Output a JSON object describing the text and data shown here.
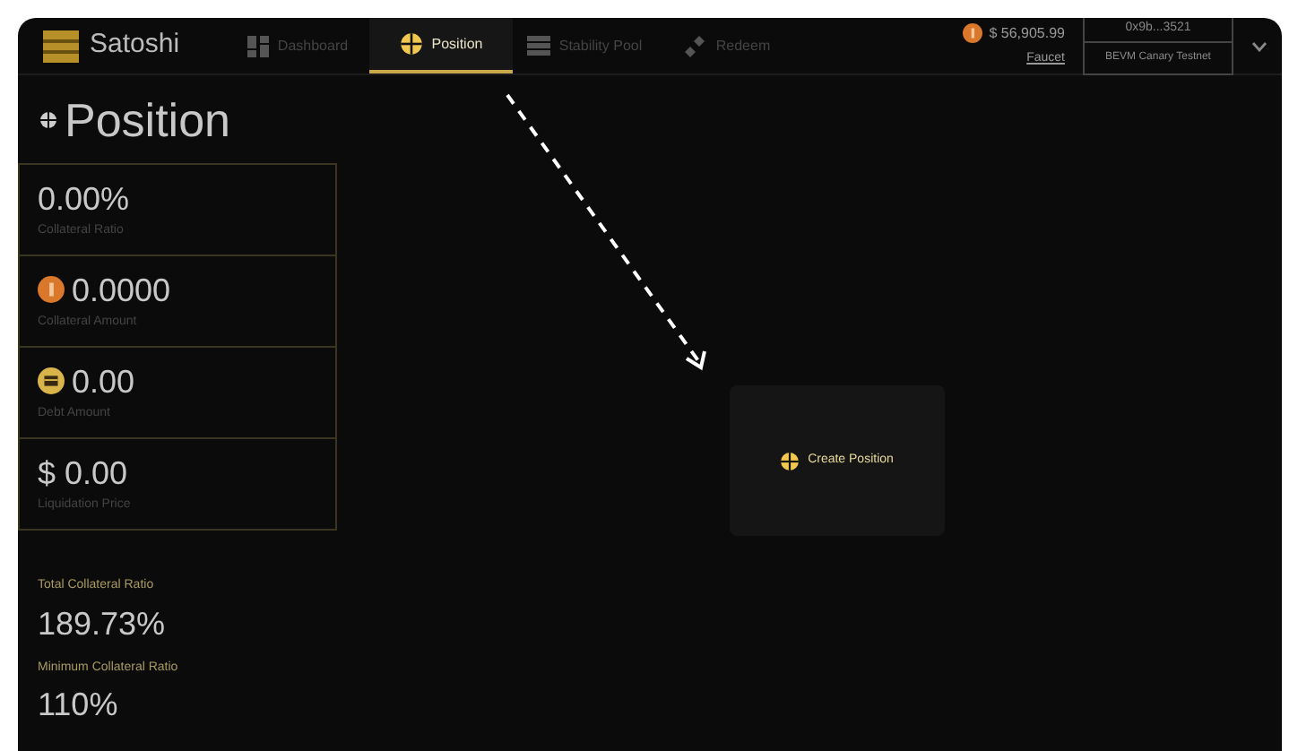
{
  "brand": "Satoshi",
  "tabs": [
    {
      "label": "Dashboard",
      "kind": "grid",
      "selected": false
    },
    {
      "label": "Position",
      "kind": "cross",
      "selected": true
    },
    {
      "label": "Stability Pool",
      "kind": "stack",
      "selected": false
    },
    {
      "label": "Redeem",
      "kind": "diamond",
      "selected": false
    }
  ],
  "balance": "$ 56,905.99",
  "faucet": "Faucet",
  "wallet": {
    "address": "0x9b...3521",
    "network": "BEVM Canary Testnet"
  },
  "page_title": "Position",
  "cards": [
    {
      "value": "0.00%",
      "label": "Collateral Ratio",
      "kind": "plain"
    },
    {
      "value": "0.0000",
      "label": "Collateral Amount",
      "kind": "coin"
    },
    {
      "value": "0.00",
      "label": "Debt Amount",
      "kind": "token"
    },
    {
      "value": "$ 0.00",
      "label": "Liquidation Price",
      "kind": "plain"
    }
  ],
  "summary": [
    {
      "label": "Total Collateral Ratio",
      "value": "189.73%"
    },
    {
      "label": "Minimum Collateral Ratio",
      "value": "110%"
    }
  ],
  "create_button": "Create Position"
}
